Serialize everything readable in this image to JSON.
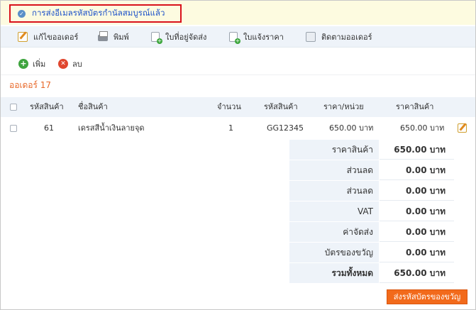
{
  "notice": {
    "message": "การส่งอีเมลรหัสบัตรกำนัลสมบูรณ์แล้ว"
  },
  "toolbar": {
    "edit_order": "แก้ไขออเดอร์",
    "print": "พิมพ์",
    "shipping_label": "ใบที่อยู่จัดส่ง",
    "quotation": "ใบแจ้งราคา",
    "track_order": "ติดตามออเดอร์"
  },
  "actions": {
    "add": "เพิ่ม",
    "delete": "ลบ"
  },
  "order": {
    "label": "ออเดอร์ 17"
  },
  "table": {
    "headers": [
      "รหัสสินค้า",
      "ชื่อสินค้า",
      "จำนวน",
      "รหัสสินค้า",
      "ราคา/หน่วย",
      "ราคาสินค้า"
    ],
    "rows": [
      {
        "id": "61",
        "name": "เดรสสีน้ำเงินลายจุด",
        "qty": "1",
        "sku": "GG12345",
        "unit_price": "650.00 บาท",
        "price": "650.00 บาท"
      }
    ]
  },
  "summary": [
    {
      "label": "ราคาสินค้า",
      "value": "650.00 บาท"
    },
    {
      "label": "ส่วนลด",
      "value": "0.00 บาท"
    },
    {
      "label": "ส่วนลด",
      "value": "0.00 บาท"
    },
    {
      "label": "VAT",
      "value": "0.00 บาท"
    },
    {
      "label": "ค่าจัดส่ง",
      "value": "0.00 บาท"
    },
    {
      "label": "บัตรของขวัญ",
      "value": "0.00 บาท"
    },
    {
      "label": "รวมทั้งหมด",
      "value": "650.00 บาท"
    }
  ],
  "send_button": "ส่งรหัสบัตรของขวัญ",
  "colors": {
    "accent": "#f26a1b",
    "notice_border": "#d9111b",
    "link": "#1f53c9",
    "header_bg": "#eef3f9"
  },
  "icons": [
    "check-icon",
    "edit-icon",
    "print-icon",
    "add-doc-icon",
    "track-icon",
    "add-icon",
    "delete-icon"
  ]
}
